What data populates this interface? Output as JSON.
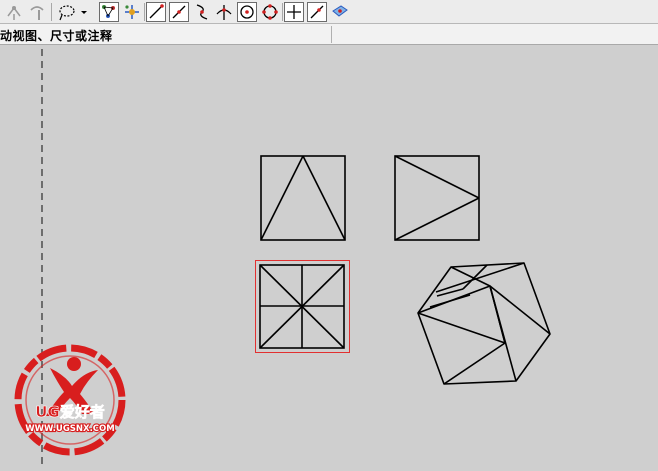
{
  "toolbar": {
    "tools": [
      "point-constructor-icon",
      "chain-constructor-icon",
      "lasso-select-icon",
      "snap-control-point-icon",
      "snap-midpoint-icon",
      "snap-endpoint-icon",
      "snap-midpoint-line-icon",
      "snap-curve-icon",
      "snap-intersection-icon",
      "snap-arc-center-icon",
      "snap-quadrant-icon",
      "snap-existing-point-icon",
      "snap-point-on-curve-icon",
      "snap-surface-icon"
    ]
  },
  "cue_line": {
    "text": "动视图、尺寸或注释"
  },
  "watermark": {
    "brand": "UG爱好者",
    "url": "WWW.UGSNX.COM",
    "color": "#d81e1e"
  },
  "colors": {
    "selection": "#e23030",
    "geometry": "#000000",
    "border_line": "#555555"
  }
}
